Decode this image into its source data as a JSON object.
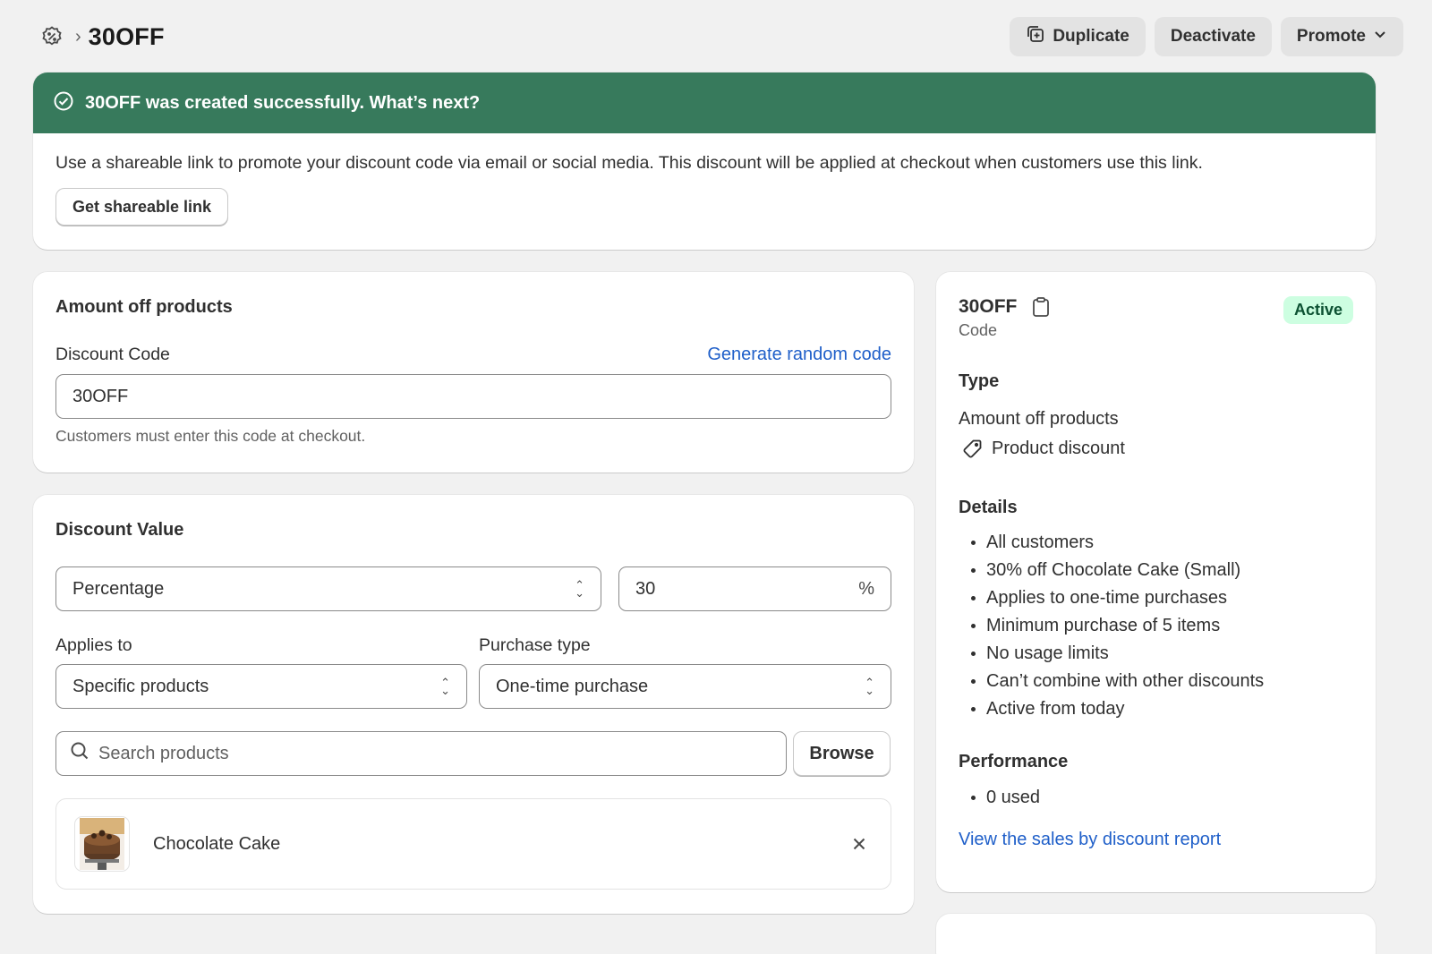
{
  "header": {
    "breadcrumb_icon": "discount-gear-icon",
    "title": "30OFF",
    "actions": {
      "duplicate": "Duplicate",
      "deactivate": "Deactivate",
      "promote": "Promote"
    }
  },
  "banner": {
    "title": "30OFF was created successfully. What’s next?",
    "body": "Use a shareable link to promote your discount code via email or social media. This discount will be applied at checkout when customers use this link.",
    "button": "Get shareable link",
    "color": "#377a5c"
  },
  "code_card": {
    "title": "Amount off products",
    "label": "Discount Code",
    "generate_link": "Generate random code",
    "value": "30OFF",
    "help": "Customers must enter this code at checkout."
  },
  "value_card": {
    "title": "Discount Value",
    "value_type": "Percentage",
    "amount": "30",
    "suffix": "%",
    "applies_to_label": "Applies to",
    "applies_to": "Specific products",
    "purchase_type_label": "Purchase type",
    "purchase_type": "One-time purchase",
    "search_placeholder": "Search products",
    "browse": "Browse",
    "product": {
      "name": "Chocolate Cake"
    }
  },
  "summary": {
    "code": "30OFF",
    "code_caption": "Code",
    "status": "Active",
    "type_heading": "Type",
    "type": "Amount off products",
    "type_detail": "Product discount",
    "details_heading": "Details",
    "details": [
      "All customers",
      "30% off Chocolate Cake (Small)",
      "Applies to one-time purchases",
      "Minimum purchase of 5 items",
      "No usage limits",
      "Can’t combine with other discounts",
      "Active from today"
    ],
    "performance_heading": "Performance",
    "performance": [
      "0 used"
    ],
    "report_link": "View the sales by discount report"
  },
  "colors": {
    "accent_link": "#1f5fc9",
    "badge_bg": "#cdfee1",
    "badge_text": "#0c5132",
    "page_bg": "#f1f1f1"
  }
}
